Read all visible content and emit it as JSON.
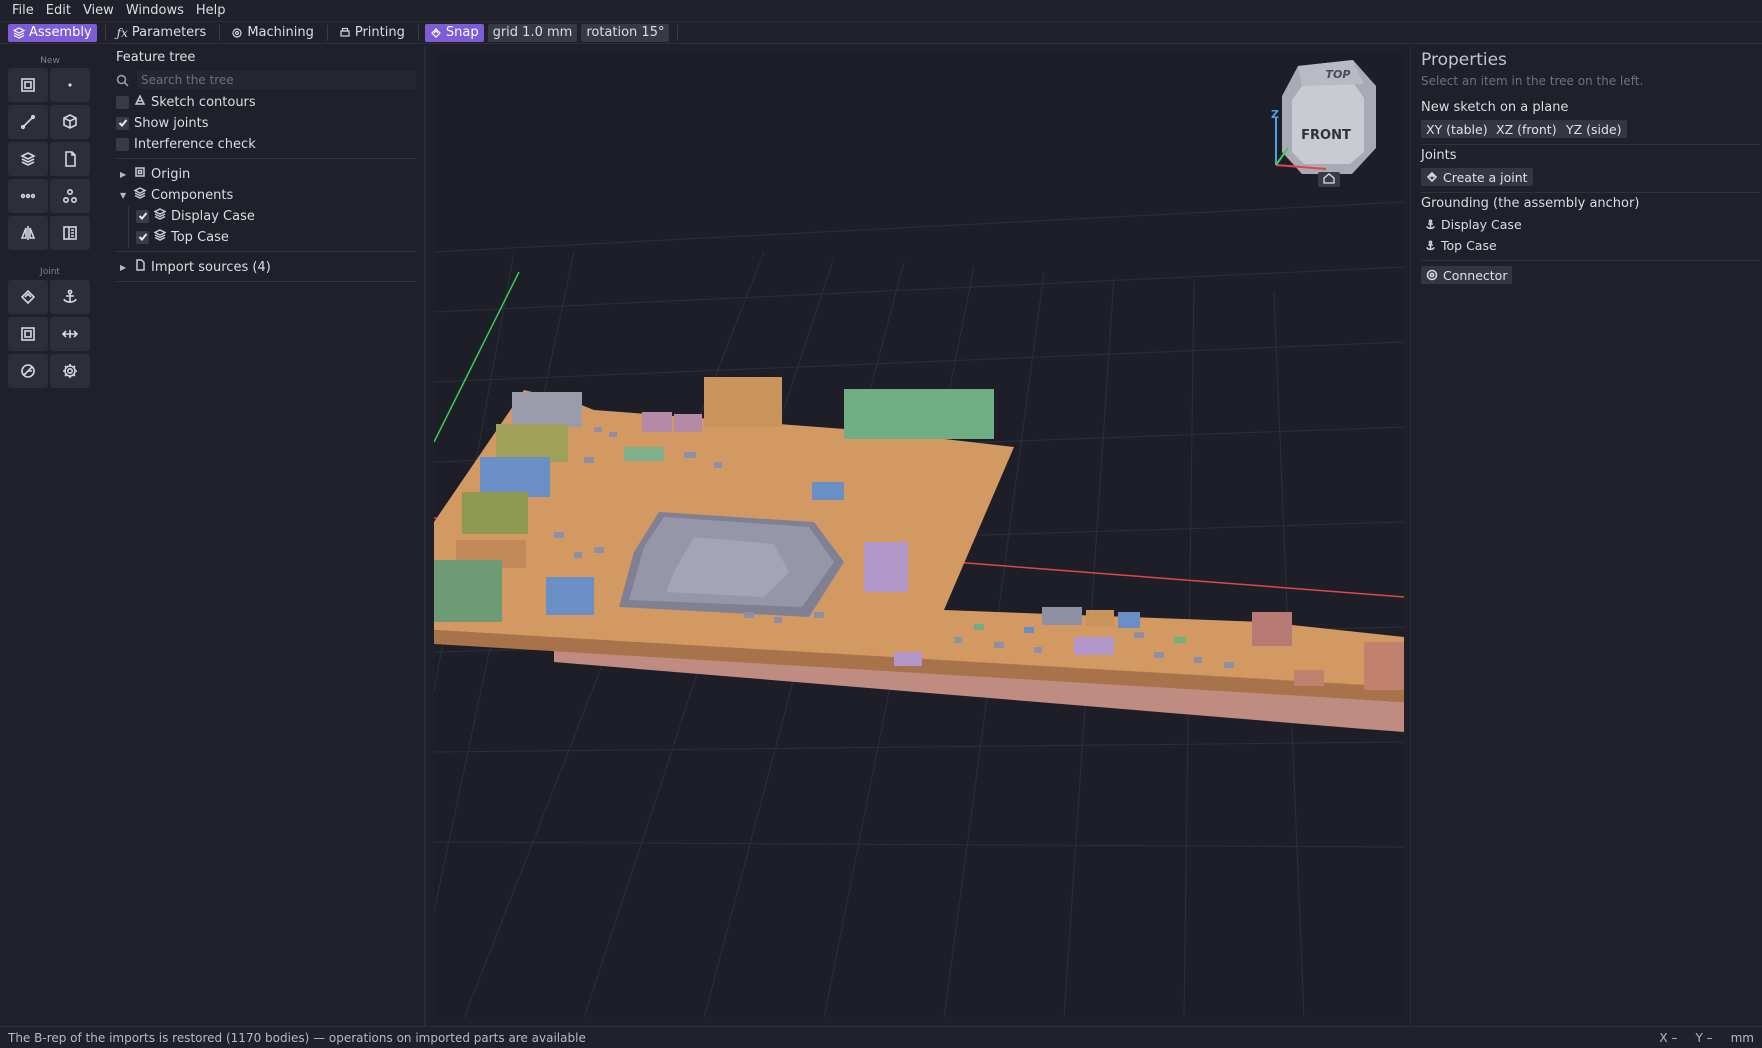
{
  "menu": [
    "File",
    "Edit",
    "View",
    "Windows",
    "Help"
  ],
  "toolbar": {
    "assembly": "Assembly",
    "parameters": "Parameters",
    "machining": "Machining",
    "printing": "Printing",
    "snap": "Snap",
    "grid": "grid 1.0 mm",
    "rotation": "rotation 15°",
    "accent": "#7d5dd6"
  },
  "palette": {
    "new_label": "New",
    "joint_label": "Joint"
  },
  "tree": {
    "title": "Feature tree",
    "search_placeholder": "Search the tree",
    "toggles": [
      {
        "label": "Sketch contours",
        "checked": false
      },
      {
        "label": "Show joints",
        "checked": true
      },
      {
        "label": "Interference check",
        "checked": false
      }
    ],
    "origin": "Origin",
    "components": "Components",
    "component_items": [
      "Display Case",
      "Top Case"
    ],
    "import_sources": "Import sources (4)"
  },
  "viewcube": {
    "top": "TOP",
    "front": "FRONT",
    "z": "Z"
  },
  "properties": {
    "title": "Properties",
    "subtitle": "Select an item in the tree on the left.",
    "sketch_heading": "New sketch on a plane",
    "planes": [
      "XY (table)",
      "XZ (front)",
      "YZ (side)"
    ],
    "joints_heading": "Joints",
    "create_joint": "Create a joint",
    "grounding_heading": "Grounding (the assembly anchor)",
    "grounding_items": [
      "Display Case",
      "Top Case"
    ],
    "connector": "Connector"
  },
  "status": {
    "message": "The B-rep of the imports is restored (1170 bodies) — operations on imported parts are available",
    "x": "X –",
    "y": "Y –",
    "unit": "mm"
  }
}
